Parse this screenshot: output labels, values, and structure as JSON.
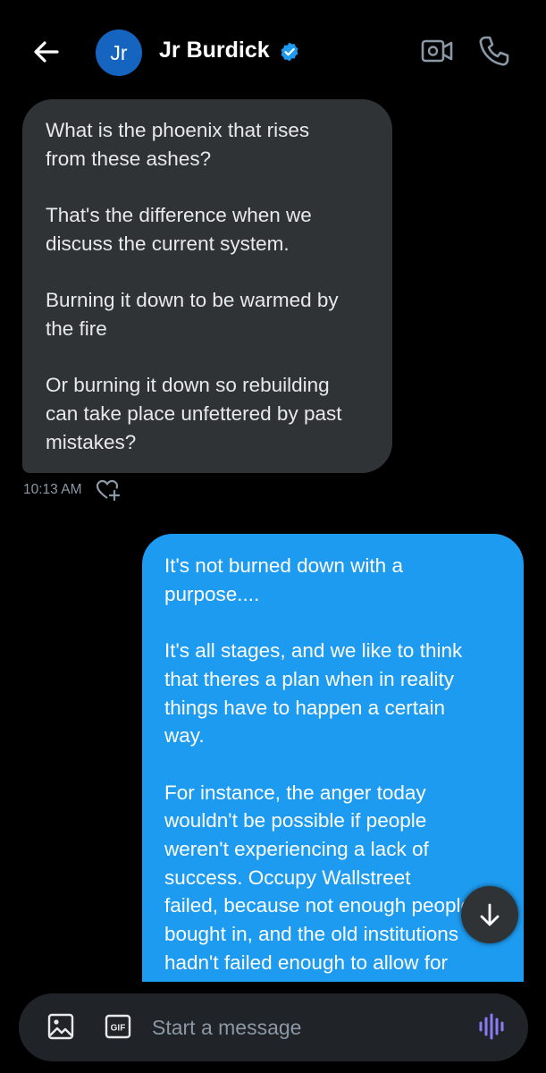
{
  "header": {
    "avatar_initials": "Jr",
    "contact_name": "Jr Burdick",
    "verified": true,
    "icons": [
      "back-arrow-icon",
      "verified-badge-icon",
      "video-call-icon",
      "phone-icon"
    ]
  },
  "messages": [
    {
      "direction": "incoming",
      "paragraphs": [
        "What is the phoenix that rises\nfrom these ashes?",
        "That's the difference when we\ndiscuss the current system.",
        "Burning it down to be warmed by\nthe fire",
        "Or burning it down so rebuilding\ncan take place unfettered by past\nmistakes?"
      ],
      "time": "10:13 AM"
    },
    {
      "direction": "outgoing",
      "paragraphs": [
        "It's not burned down with a\npurpose....",
        "It's all stages, and we like to think\nthat theres a plan when in reality\nthings have to happen a certain\nway.",
        "For instance, the anger today\nwouldn't be possible if people\nweren't experiencing a lack of\nsuccess.  Occupy Wallstreet\nfailed, because not enough people\nbought in, and the old institutions\nhadn't failed enough to allow for"
      ]
    }
  ],
  "composer": {
    "placeholder": "Start a message",
    "gif_label": "GIF"
  },
  "colors": {
    "background": "#000000",
    "incoming_bubble": "#2f3336",
    "outgoing_bubble": "#1d9bf0",
    "avatar": "#1565c0",
    "verified": "#1d9bf0",
    "voice_accent": "#8b7cf6"
  }
}
